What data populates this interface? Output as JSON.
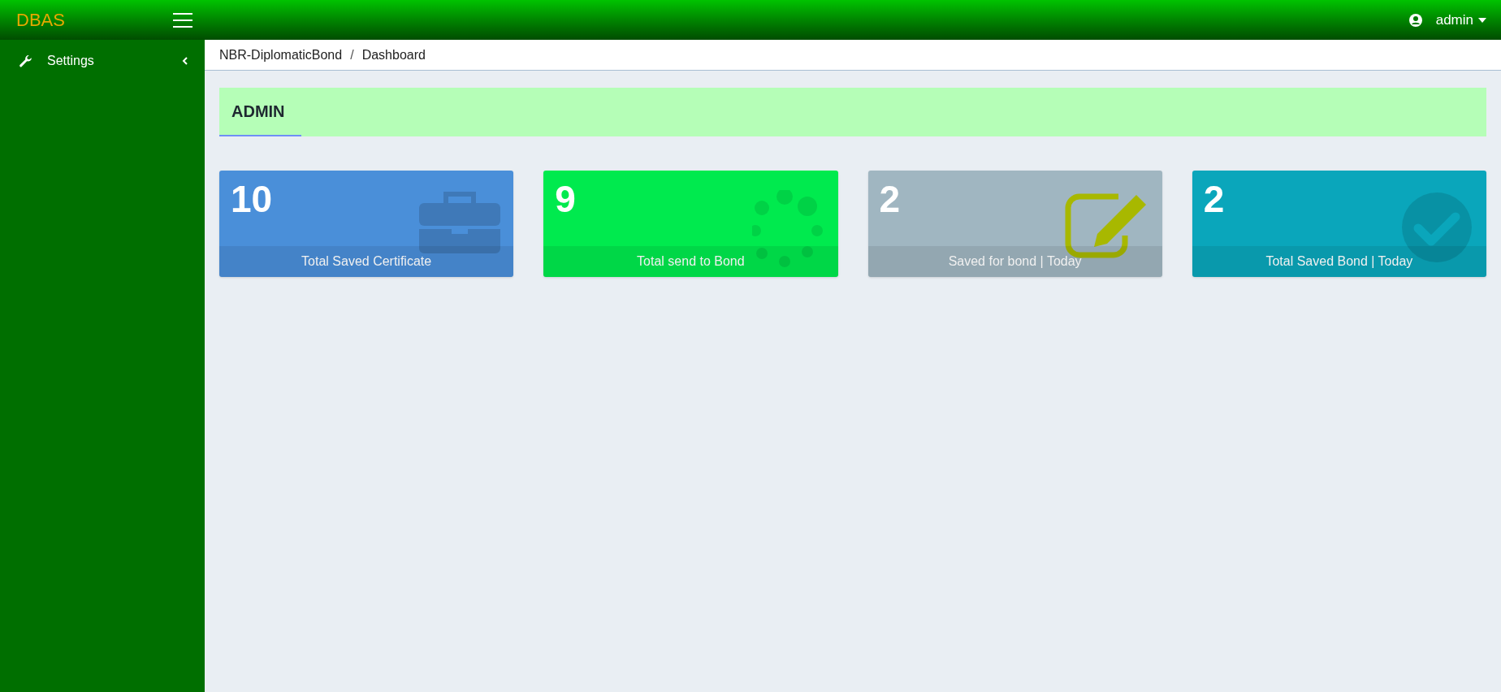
{
  "topbar": {
    "brand": "DBAS",
    "user": "admin"
  },
  "sidebar": {
    "items": [
      {
        "label": "Settings",
        "expanded": false
      }
    ]
  },
  "breadcrumb": {
    "items": [
      "NBR-DiplomaticBond",
      "Dashboard"
    ],
    "separator": "/"
  },
  "section_title": "ADMIN",
  "cards": [
    {
      "kind": "briefcase",
      "value": "10",
      "label": "Total Saved Certificate",
      "color": "#4a8fd9"
    },
    {
      "kind": "spinner",
      "value": "9",
      "label": "Total send to Bond",
      "color": "#00ea4e"
    },
    {
      "kind": "edit",
      "value": "2",
      "label": "Saved for bond | Today",
      "color": "#a0b6c1"
    },
    {
      "kind": "check",
      "value": "2",
      "label": "Total Saved Bond | Today",
      "color": "#0aa6bb"
    }
  ]
}
